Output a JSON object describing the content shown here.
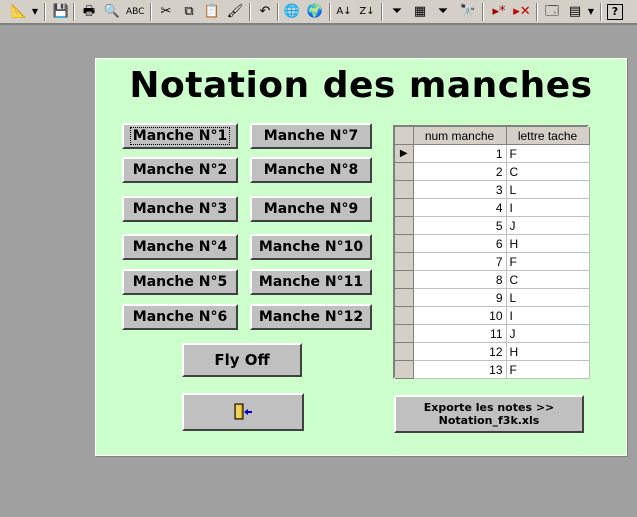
{
  "toolbar": {
    "icons": [
      "design-view-icon",
      "save-icon",
      "print-icon",
      "print-preview-icon",
      "spelling-icon",
      "cut-icon",
      "copy-icon",
      "paste-icon",
      "format-painter-icon",
      "undo-icon",
      "hyperlink-icon",
      "web-toolbar-icon",
      "sort-ascending-icon",
      "sort-descending-icon",
      "filter-by-selection-icon",
      "filter-by-form-icon",
      "apply-filter-icon",
      "find-icon",
      "new-record-icon",
      "delete-record-icon",
      "properties-icon",
      "new-object-icon",
      "help-icon"
    ]
  },
  "form": {
    "title": "Notation des manches",
    "manche_buttons": [
      "Manche N°1",
      "Manche N°2",
      "Manche N°3",
      "Manche N°4",
      "Manche N°5",
      "Manche N°6",
      "Manche N°7",
      "Manche N°8",
      "Manche N°9",
      "Manche N°10",
      "Manche N°11",
      "Manche N°12"
    ],
    "flyoff_label": "Fly Off",
    "exit_icon": "exit-door-icon",
    "export_line1": "Exporte les notes >>",
    "export_line2": "Notation_f3k.xls"
  },
  "datasheet": {
    "columns": [
      "num manche",
      "lettre tache"
    ],
    "current_record_marker": "▶",
    "rows": [
      [
        "1",
        "F"
      ],
      [
        "2",
        "C"
      ],
      [
        "3",
        "L"
      ],
      [
        "4",
        "I"
      ],
      [
        "5",
        "J"
      ],
      [
        "6",
        "H"
      ],
      [
        "7",
        "F"
      ],
      [
        "8",
        "C"
      ],
      [
        "9",
        "L"
      ],
      [
        "10",
        "I"
      ],
      [
        "11",
        "J"
      ],
      [
        "12",
        "H"
      ],
      [
        "13",
        "F"
      ]
    ]
  }
}
